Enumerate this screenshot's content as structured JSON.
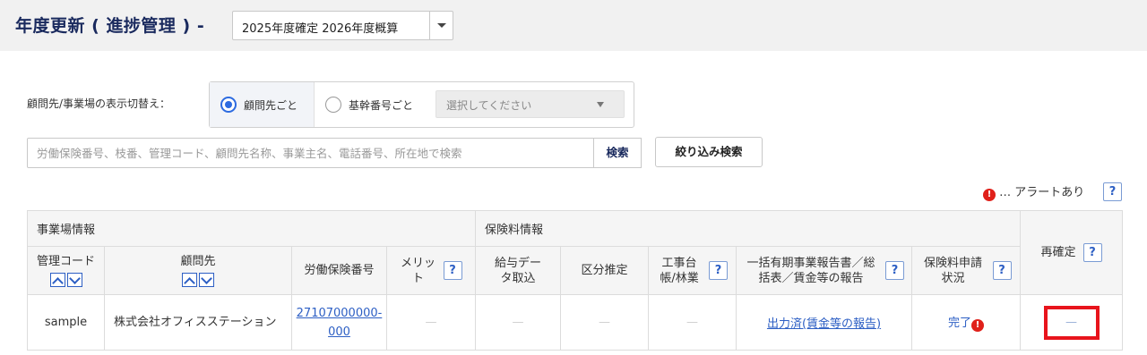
{
  "header": {
    "title": "年度更新 ( 進捗管理 ) -",
    "year_select": "2025年度確定 2026年度概算"
  },
  "display_toggle": {
    "label": "顧問先/事業場の表示切替え：",
    "option_client": "顧問先ごと",
    "option_number": "基幹番号ごと",
    "select_placeholder": "選択してください"
  },
  "search": {
    "placeholder": "労働保険番号、枝番、管理コード、顧問先名称、事業主名、電話番号、所在地で検索",
    "search_button": "検索",
    "filter_button": "絞り込み検索"
  },
  "legend": {
    "alert_icon": "!",
    "alert_text": "… アラートあり",
    "help": "?"
  },
  "table": {
    "groups": {
      "site_info": "事業場情報",
      "premium_info": "保険料情報",
      "reconfirm": "再確定"
    },
    "columns": {
      "mgmt_code": "管理コード",
      "client": "顧問先",
      "insurance_number": "労働保険番号",
      "merit": "メリット",
      "salary_import": "給与データ取込",
      "classification": "区分推定",
      "ledger": "工事台帳/林業",
      "report": "一括有期事業報告書／総括表／賃金等の報告",
      "application_status": "保険料申請状況"
    },
    "help": "?",
    "rows": [
      {
        "mgmt_code": "sample",
        "client": "株式会社オフィスステーション",
        "insurance_number": "27107000000-000",
        "merit": "—",
        "salary_import": "—",
        "classification": "—",
        "ledger": "—",
        "report": "出力済(賃金等の報告)",
        "status": "完了",
        "status_alert": "!",
        "reconfirm": "—"
      }
    ]
  }
}
